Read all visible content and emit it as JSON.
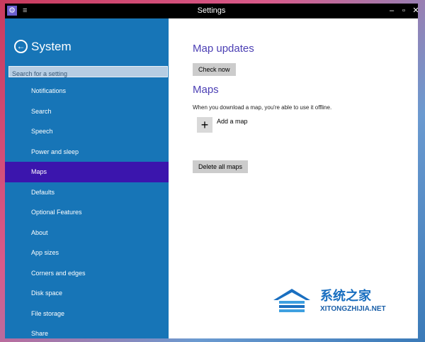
{
  "window": {
    "title": "Settings",
    "app_icon": "gear-icon",
    "menu_icon": "hamburger-icon",
    "minimize": "–",
    "maximize": "▫",
    "close": "✕"
  },
  "sidebar": {
    "back_icon": "arrow-left-icon",
    "title": "System",
    "search_placeholder": "Search for a setting",
    "items": [
      {
        "label": "Notifications",
        "selected": false
      },
      {
        "label": "Search",
        "selected": false
      },
      {
        "label": "Speech",
        "selected": false
      },
      {
        "label": "Power and sleep",
        "selected": false
      },
      {
        "label": "Maps",
        "selected": true
      },
      {
        "label": "Defaults",
        "selected": false
      },
      {
        "label": "Optional Features",
        "selected": false
      },
      {
        "label": "About",
        "selected": false
      },
      {
        "label": "App sizes",
        "selected": false
      },
      {
        "label": "Corners and edges",
        "selected": false
      },
      {
        "label": "Disk space",
        "selected": false
      },
      {
        "label": "File storage",
        "selected": false
      },
      {
        "label": "Share",
        "selected": false
      }
    ]
  },
  "main": {
    "map_updates_heading": "Map updates",
    "check_now_label": "Check now",
    "maps_heading": "Maps",
    "maps_description": "When you download a map, you're able to use it offline.",
    "add_map_icon": "plus-icon",
    "add_map_label": "Add a map",
    "delete_all_label": "Delete all maps"
  },
  "watermark": {
    "chinese": "系统之家",
    "site": "XITONGZHIJIA.NET"
  },
  "colors": {
    "sidebar_bg": "#1775b7",
    "selected_bg": "#3b15ad",
    "heading": "#4b3fb4",
    "button_bg": "#cccccc",
    "titlebar_bg": "#000000"
  }
}
